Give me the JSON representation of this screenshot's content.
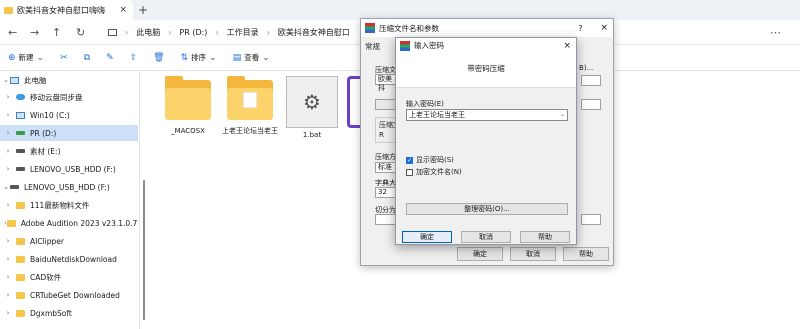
{
  "window": {
    "tab_title": "欧美抖音女神自慰口嗨嗨",
    "tab_close": "×",
    "new_tab": "+"
  },
  "address": {
    "back": "←",
    "forward": "→",
    "up": "↑",
    "refresh": "↻",
    "crumbs": [
      "此电脑",
      "PR (D:)",
      "工作目录",
      "欧美抖音女神自慰口"
    ],
    "sep": "›",
    "more": "⋯"
  },
  "toolbar": {
    "new_label": "新建",
    "sort_label": "排序",
    "view_label": "查看"
  },
  "sidebar": {
    "items": [
      {
        "label": "此电脑",
        "chev": "⌄",
        "kind": "pc"
      },
      {
        "label": "移动云盘同步盘",
        "chev": "›",
        "kind": "cloud"
      },
      {
        "label": "Win10 (C:)",
        "chev": "›",
        "kind": "drive"
      },
      {
        "label": "PR (D:)",
        "chev": "›",
        "kind": "drive"
      },
      {
        "label": "素材 (E:)",
        "chev": "›",
        "kind": "drive"
      },
      {
        "label": "LENOVO_USB_HDD (F:)",
        "chev": "›",
        "kind": "drive"
      },
      {
        "label": "LENOVO_USB_HDD (F:)",
        "chev": "⌄",
        "kind": "drive"
      },
      {
        "label": "111最新物料文件",
        "chev": "›",
        "kind": "folder"
      },
      {
        "label": "Adobe Audition 2023 v23.1.0.75",
        "chev": "›",
        "kind": "folder"
      },
      {
        "label": "AIClipper",
        "chev": "›",
        "kind": "folder"
      },
      {
        "label": "BaiduNetdiskDownload",
        "chev": "›",
        "kind": "folder"
      },
      {
        "label": "CAD软件",
        "chev": "›",
        "kind": "folder"
      },
      {
        "label": "CRTubeGet Downloaded",
        "chev": "›",
        "kind": "folder"
      },
      {
        "label": "DgxmbSoft",
        "chev": "›",
        "kind": "folder"
      }
    ]
  },
  "files": [
    {
      "name": "_MACOSX",
      "kind": "folder"
    },
    {
      "name": "上老王论坛当老王",
      "kind": "folder"
    },
    {
      "name": "1.bat",
      "kind": "bat"
    }
  ],
  "rar_dialog": {
    "title": "压缩文件名和参数",
    "help": "?",
    "close": "×",
    "tab_general": "常规",
    "lbl_archive": "压缩文",
    "archive_value": "欧美抖",
    "lbl_format": "压缩文",
    "radio_rar": "R",
    "lbl_method": "压缩方",
    "method_value": "标准",
    "lbl_dict": "字典大",
    "dict_value": "32",
    "lbl_split": "切分为",
    "right_frag": "B)...",
    "ok": "确定",
    "cancel": "取消",
    "help_btn": "帮助"
  },
  "pwd_dialog": {
    "title": "输入密码",
    "close": "×",
    "heading": "带密码压缩",
    "lbl_enter": "输入密码(E)",
    "value": "上老王论坛当老王",
    "dropdown": "⌄",
    "show_pwd": "显示密码(S)",
    "encrypt_names": "加密文件名(N)",
    "manager": "整理密码(O)...",
    "ok": "确定",
    "cancel": "取消",
    "help": "帮助"
  },
  "icons": {
    "tab_folder": "folder-icon",
    "gear": "⚙",
    "cut": "✂",
    "copy": "⧉",
    "rename": "✎",
    "share": "⇪",
    "delete": "🗑",
    "sort": "⇅"
  }
}
